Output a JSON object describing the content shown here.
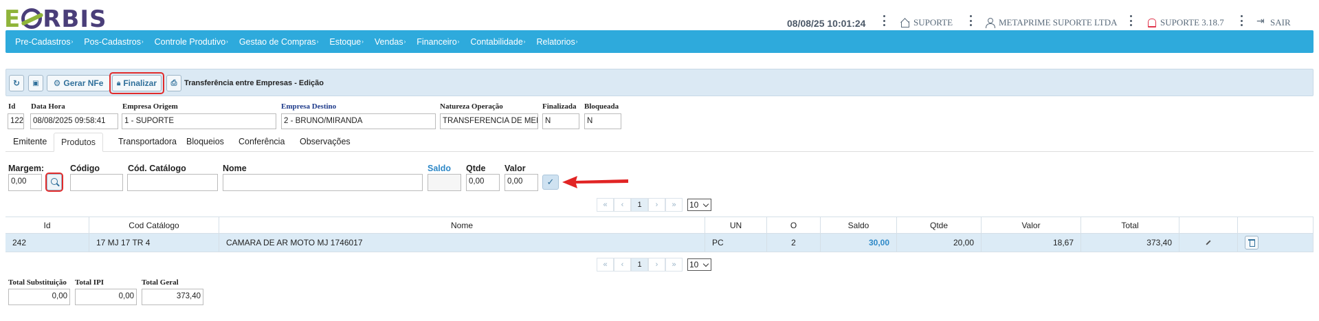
{
  "app": {
    "logo_prefix": "E",
    "logo_suffix": "RBIS",
    "datetime": "08/08/25 10:01:24",
    "branch": "SUPORTE",
    "company": "METAPRIME SUPORTE LTDA",
    "version": "SUPORTE 3.18.7",
    "exit": "SAIR"
  },
  "nav": [
    "Pre-Cadastros",
    "Pos-Cadastros",
    "Controle Produtivo",
    "Gestao de Compras",
    "Estoque",
    "Vendas",
    "Financeiro",
    "Contabilidade",
    "Relatorios"
  ],
  "toolbar": {
    "gerar_nfe": "Gerar NFe",
    "finalizar": "Finalizar",
    "title": "Transferência entre Empresas - Edição"
  },
  "form": {
    "labels": {
      "id": "Id",
      "data_hora": "Data Hora",
      "empresa_origem": "Empresa Origem",
      "empresa_destino": "Empresa Destino",
      "natureza": "Natureza Operação",
      "finalizada": "Finalizada",
      "bloqueada": "Bloqueada"
    },
    "values": {
      "id": "122",
      "data_hora": "08/08/2025 09:58:41",
      "empresa_origem": "1 - SUPORTE",
      "empresa_destino": "2 - BRUNO/MIRANDA",
      "natureza": "TRANSFERENCIA DE MERC",
      "finalizada": "N",
      "bloqueada": "N"
    }
  },
  "tabs": [
    "Emitente",
    "Produtos",
    "Transportadora",
    "Bloqueios",
    "Conferência",
    "Observações"
  ],
  "active_tab": "Produtos",
  "search": {
    "labels": {
      "margem": "Margem:",
      "codigo": "Código",
      "cod_catalogo": "Cód. Catálogo",
      "nome": "Nome",
      "saldo": "Saldo",
      "qtde": "Qtde",
      "valor": "Valor"
    },
    "values": {
      "margem": "0,00",
      "codigo": "",
      "cod_catalogo": "",
      "nome": "",
      "saldo": "",
      "qtde": "0,00",
      "valor": "0,00"
    }
  },
  "pager": {
    "first": "«",
    "prev": "‹",
    "page": "1",
    "next": "›",
    "last": "»",
    "page_size": "10"
  },
  "table": {
    "headers": [
      "Id",
      "Cod Catálogo",
      "Nome",
      "UN",
      "O",
      "Saldo",
      "Qtde",
      "Valor",
      "Total"
    ],
    "rows": [
      {
        "id": "242",
        "cod_catalogo": "17 MJ 17 TR 4",
        "nome": "CAMARA DE AR MOTO MJ 1746017",
        "un": "PC",
        "o": "2",
        "saldo": "30,00",
        "qtde": "20,00",
        "valor": "18,67",
        "total": "373,40"
      }
    ]
  },
  "totals": {
    "labels": {
      "substituicao": "Total Substituição",
      "ipi": "Total IPI",
      "geral": "Total Geral"
    },
    "values": {
      "substituicao": "0,00",
      "ipi": "0,00",
      "geral": "373,40"
    }
  }
}
